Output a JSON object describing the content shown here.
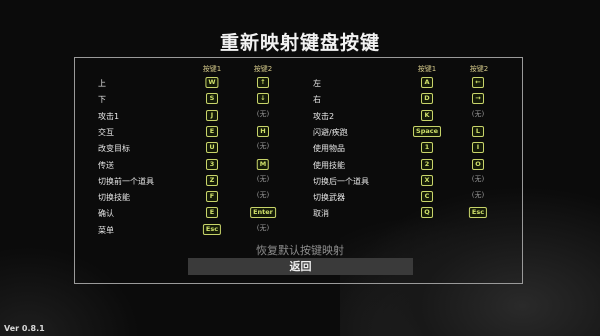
{
  "title": "重新映射键盘按键",
  "column_headers": [
    "按键1",
    "按键2",
    "按键1",
    "按键2"
  ],
  "left_rows": [
    {
      "label": "上",
      "key1": "W",
      "key2": "↑"
    },
    {
      "label": "下",
      "key1": "S",
      "key2": "↓"
    },
    {
      "label": "攻击1",
      "key1": "J",
      "key2": "(无)"
    },
    {
      "label": "交互",
      "key1": "E",
      "key2": "H"
    },
    {
      "label": "改变目标",
      "key1": "U",
      "key2": "(无)"
    },
    {
      "label": "传送",
      "key1": "3",
      "key2": "M"
    },
    {
      "label": "切换前一个道具",
      "key1": "Z",
      "key2": "(无)"
    },
    {
      "label": "切换技能",
      "key1": "F",
      "key2": "(无)"
    },
    {
      "label": "确认",
      "key1": "E",
      "key2": "Enter"
    },
    {
      "label": "菜单",
      "key1": "Esc",
      "key2": "(无)"
    }
  ],
  "right_rows": [
    {
      "label": "左",
      "key1": "A",
      "key2": "←"
    },
    {
      "label": "右",
      "key1": "D",
      "key2": "→"
    },
    {
      "label": "攻击2",
      "key1": "K",
      "key2": "(无)"
    },
    {
      "label": "闪避/疾跑",
      "key1": "Space",
      "key2": "L"
    },
    {
      "label": "使用物品",
      "key1": "1",
      "key2": "I"
    },
    {
      "label": "使用技能",
      "key1": "2",
      "key2": "O"
    },
    {
      "label": "切换后一个道具",
      "key1": "X",
      "key2": "(无)"
    },
    {
      "label": "切换武器",
      "key1": "C",
      "key2": "(无)"
    },
    {
      "label": "取消",
      "key1": "Q",
      "key2": "Esc"
    }
  ],
  "reset_label": "恢复默认按键映射",
  "back_label": "返回",
  "version": "Ver 0.8.1",
  "colors": {
    "key_border": "#c8d46a",
    "key_text": "#cfe06a",
    "header": "#d4c98a",
    "background": "#0b0b0b"
  }
}
